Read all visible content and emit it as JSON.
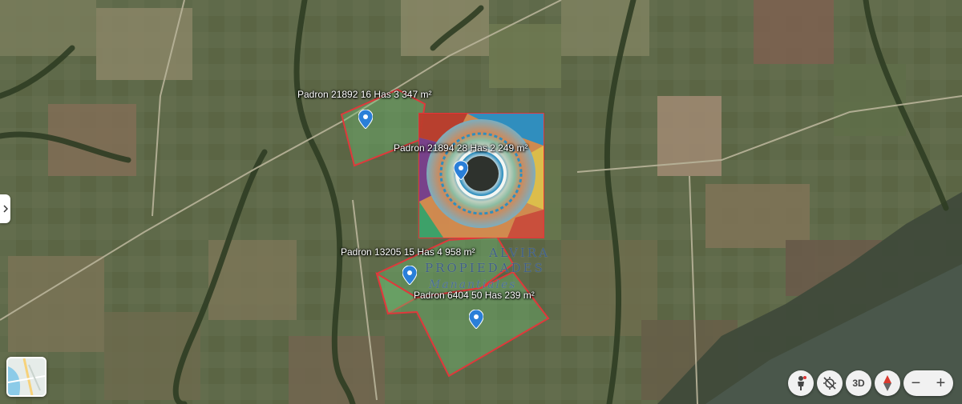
{
  "map": {
    "view": "satellite",
    "boundary_color": "#e0383b",
    "parcel_fill": "#6bbf73",
    "pin_color": "#2a7fd8"
  },
  "parcels": [
    {
      "label": "Padron 21892  16 Has 3 347 m²"
    },
    {
      "label": "Padron 21894  28 Has 2 249 m²"
    },
    {
      "label": "Padron 13205  15 Has 4 958 m²"
    },
    {
      "label": "Padron 6404  50 Has 239 m²"
    }
  ],
  "watermark": {
    "line1": "ALVIRA",
    "line2": "PROPIEDADES",
    "line3": "Manantiales"
  },
  "controls": {
    "pegman_icon": "pegman-icon",
    "orientation_icon": "orientation-icon",
    "mode_3d": "3D",
    "compass_icon": "compass-icon",
    "zoom_out": "−",
    "zoom_in": "+"
  }
}
